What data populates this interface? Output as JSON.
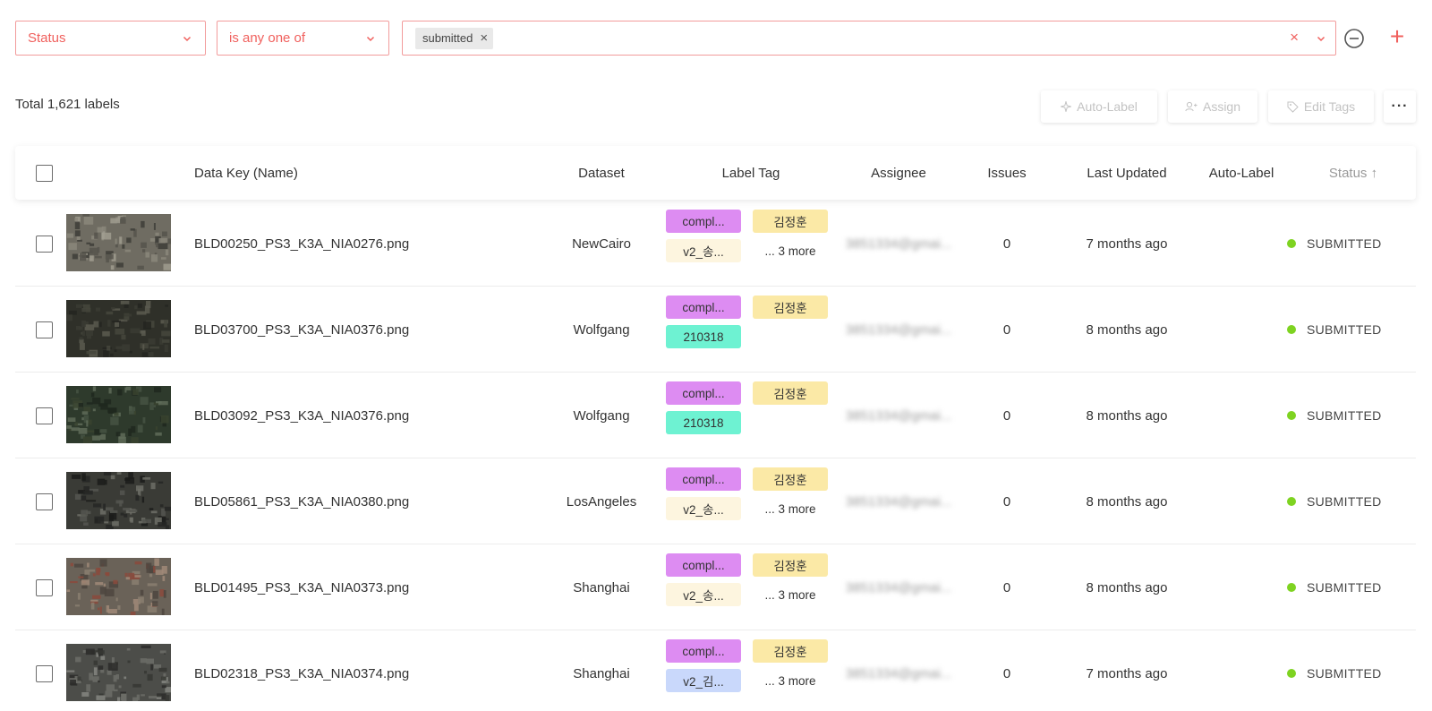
{
  "colors": {
    "accent": "#f0605d",
    "accent_border": "#f29b9b",
    "status_dot": "#7ed321",
    "tag_completed": "#dd8cf2",
    "tag_user": "#fbe9a6",
    "tag_v2": "#fdf5df",
    "tag_date": "#6ef2d2",
    "tag_v2_kim": "#c9d8fb"
  },
  "filter": {
    "field": "Status",
    "operator": "is any one of",
    "chips": [
      "submitted"
    ],
    "chip_remove_icon": "×",
    "clear_icon": "×",
    "remove_filter_icon": "minus-circle-icon",
    "add_filter_icon": "+"
  },
  "toolbar": {
    "total": "Total 1,621 labels",
    "auto_label": "Auto-Label",
    "assign": "Assign",
    "edit_tags": "Edit Tags",
    "more": "···"
  },
  "table": {
    "headers": {
      "data_key": "Data Key (Name)",
      "dataset": "Dataset",
      "label_tag": "Label Tag",
      "assignee": "Assignee",
      "issues": "Issues",
      "last_updated": "Last Updated",
      "auto_label": "Auto-Label",
      "status": "Status ↑"
    },
    "rows": [
      {
        "name": "BLD00250_PS3_K3A_NIA0276.png",
        "dataset": "NewCairo",
        "tags": [
          {
            "text": "compl...",
            "kind": "completed"
          },
          {
            "text": "김정훈",
            "kind": "user"
          },
          {
            "text": "v2_송...",
            "kind": "v2"
          }
        ],
        "more": "... 3 more",
        "assignee": "3851334@gmai...",
        "issues": "0",
        "updated": "7 months ago",
        "status": "SUBMITTED",
        "thumb": "t0"
      },
      {
        "name": "BLD03700_PS3_K3A_NIA0376.png",
        "dataset": "Wolfgang",
        "tags": [
          {
            "text": "compl...",
            "kind": "completed"
          },
          {
            "text": "김정훈",
            "kind": "user"
          },
          {
            "text": "210318",
            "kind": "date"
          }
        ],
        "more": "",
        "assignee": "3851334@gmai...",
        "issues": "0",
        "updated": "8 months ago",
        "status": "SUBMITTED",
        "thumb": "t1"
      },
      {
        "name": "BLD03092_PS3_K3A_NIA0376.png",
        "dataset": "Wolfgang",
        "tags": [
          {
            "text": "compl...",
            "kind": "completed"
          },
          {
            "text": "김정훈",
            "kind": "user"
          },
          {
            "text": "210318",
            "kind": "date"
          }
        ],
        "more": "",
        "assignee": "3851334@gmai...",
        "issues": "0",
        "updated": "8 months ago",
        "status": "SUBMITTED",
        "thumb": "t2"
      },
      {
        "name": "BLD05861_PS3_K3A_NIA0380.png",
        "dataset": "LosAngeles",
        "tags": [
          {
            "text": "compl...",
            "kind": "completed"
          },
          {
            "text": "김정훈",
            "kind": "user"
          },
          {
            "text": "v2_송...",
            "kind": "v2"
          }
        ],
        "more": "... 3 more",
        "assignee": "3851334@gmai...",
        "issues": "0",
        "updated": "8 months ago",
        "status": "SUBMITTED",
        "thumb": "t3"
      },
      {
        "name": "BLD01495_PS3_K3A_NIA0373.png",
        "dataset": "Shanghai",
        "tags": [
          {
            "text": "compl...",
            "kind": "completed"
          },
          {
            "text": "김정훈",
            "kind": "user"
          },
          {
            "text": "v2_송...",
            "kind": "v2"
          }
        ],
        "more": "... 3 more",
        "assignee": "3851334@gmai...",
        "issues": "0",
        "updated": "8 months ago",
        "status": "SUBMITTED",
        "thumb": "t4"
      },
      {
        "name": "BLD02318_PS3_K3A_NIA0374.png",
        "dataset": "Shanghai",
        "tags": [
          {
            "text": "compl...",
            "kind": "completed"
          },
          {
            "text": "김정훈",
            "kind": "user"
          },
          {
            "text": "v2_김...",
            "kind": "v2_kim"
          }
        ],
        "more": "... 3 more",
        "assignee": "3851334@gmai...",
        "issues": "0",
        "updated": "7 months ago",
        "status": "SUBMITTED",
        "thumb": "t5"
      }
    ]
  }
}
